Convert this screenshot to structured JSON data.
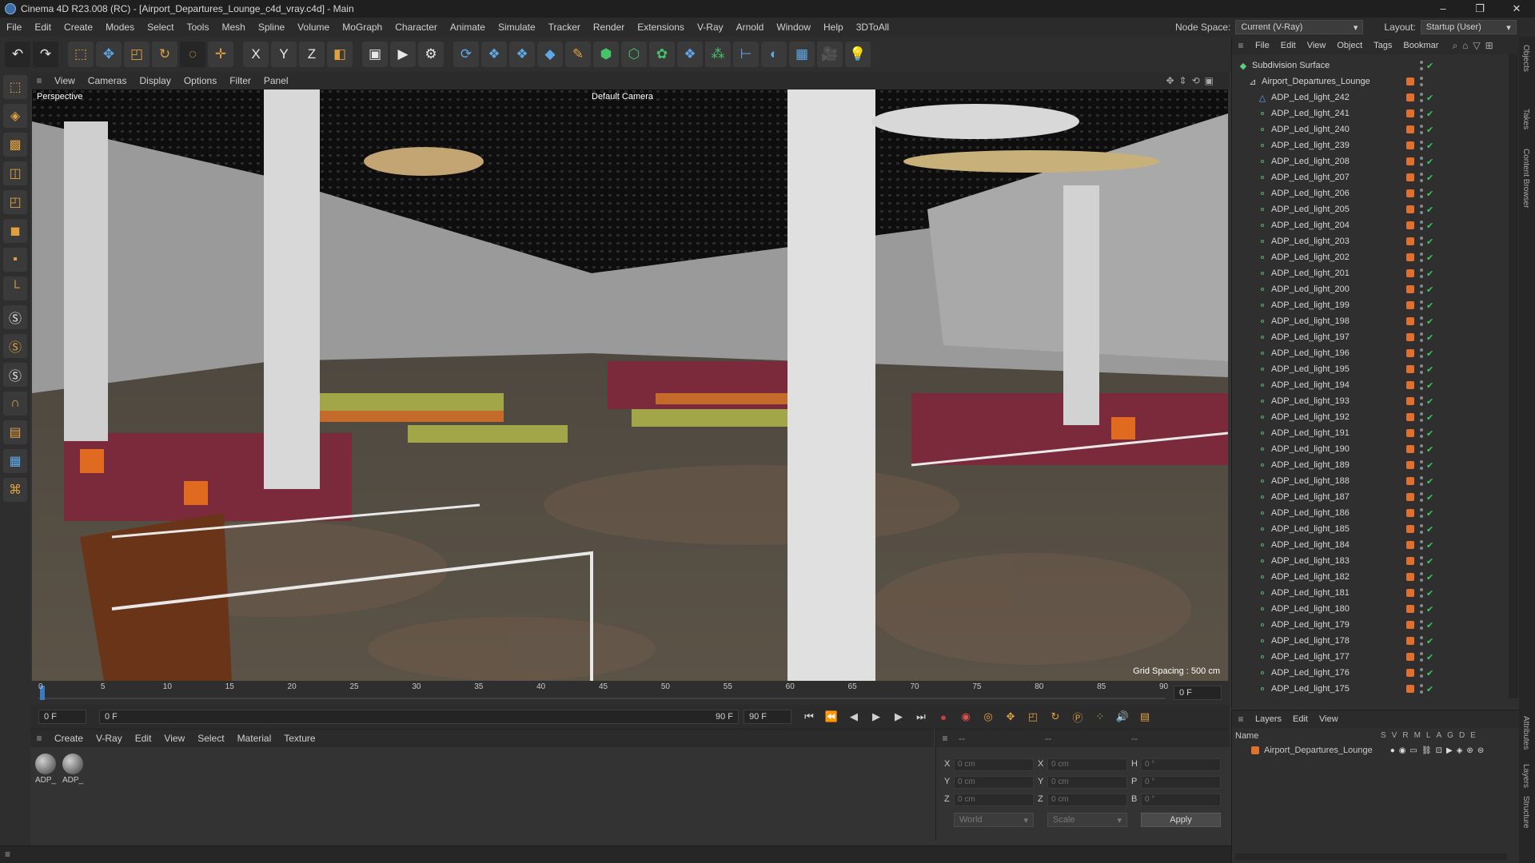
{
  "window": {
    "title": "Cinema 4D R23.008 (RC) - [Airport_Departures_Lounge_c4d_vray.c4d] - Main",
    "controls": [
      "–",
      "❐",
      "✕"
    ]
  },
  "menu": {
    "items": [
      "File",
      "Edit",
      "Create",
      "Modes",
      "Select",
      "Tools",
      "Mesh",
      "Spline",
      "Volume",
      "MoGraph",
      "Character",
      "Animate",
      "Simulate",
      "Tracker",
      "Render",
      "Extensions",
      "V-Ray",
      "Arnold",
      "Window",
      "Help",
      "3DToAll"
    ],
    "node_space_label": "Node Space:",
    "node_space_value": "Current (V-Ray)",
    "layout_label": "Layout:",
    "layout_value": "Startup (User)"
  },
  "toolbar": {
    "icons": [
      "undo-icon",
      "redo-icon",
      "live-selection-icon",
      "move-icon",
      "scale-icon",
      "rotate-icon",
      "recent-tools-icon",
      "transform-icon",
      "x-axis-icon",
      "y-axis-icon",
      "z-axis-icon",
      "coordinate-system-icon",
      "render-view-icon",
      "render-picture-viewer-icon",
      "render-settings-icon",
      "vray-icon",
      "python-icon",
      "python-icon",
      "cube-icon",
      "pen-icon",
      "subdivision-icon",
      "extrude-icon",
      "cloner-icon",
      "python-icon",
      "mograph-icon",
      "measure-icon",
      "deformer-icon",
      "floor-icon",
      "camera-icon",
      "light-icon"
    ],
    "axis_labels": [
      "X",
      "Y",
      "Z"
    ]
  },
  "viewport": {
    "menu": [
      "View",
      "Cameras",
      "Display",
      "Options",
      "Filter",
      "Panel"
    ],
    "projection": "Perspective",
    "camera": "Default Camera",
    "grid_spacing": "Grid Spacing : 500 cm"
  },
  "timeline": {
    "ticks": [
      "0",
      "5",
      "10",
      "15",
      "20",
      "25",
      "30",
      "35",
      "40",
      "45",
      "50",
      "55",
      "60",
      "65",
      "70",
      "75",
      "80",
      "85",
      "90"
    ],
    "current_frame_field": "0 F",
    "range_start": "0 F",
    "range_end": "90 F",
    "max_frame": "90 F",
    "end_frame_field": "0 F"
  },
  "material_manager": {
    "menu": [
      "Create",
      "V-Ray",
      "Edit",
      "View",
      "Select",
      "Material",
      "Texture"
    ],
    "materials": [
      "ADP_",
      "ADP_"
    ]
  },
  "coordinates": {
    "pos_labels": [
      "X",
      "Y",
      "Z"
    ],
    "size_labels": [
      "X",
      "Y",
      "Z"
    ],
    "rot_labels": [
      "H",
      "P",
      "B"
    ],
    "pos_values": [
      "0 cm",
      "0 cm",
      "0 cm"
    ],
    "size_values": [
      "0 cm",
      "0 cm",
      "0 cm"
    ],
    "rot_values": [
      "0 °",
      "0 °",
      "0 °"
    ],
    "header_a": "--",
    "header_b": "--",
    "header_c": "--",
    "world_select": "World",
    "scale_select": "Scale",
    "apply_label": "Apply"
  },
  "object_manager": {
    "menu": [
      "File",
      "Edit",
      "View",
      "Object",
      "Tags",
      "Bookmar"
    ],
    "root_items": [
      "Subdivision Surface",
      "Airport_Departures_Lounge"
    ],
    "lights": [
      "ADP_Led_light_242",
      "ADP_Led_light_241",
      "ADP_Led_light_240",
      "ADP_Led_light_239",
      "ADP_Led_light_208",
      "ADP_Led_light_207",
      "ADP_Led_light_206",
      "ADP_Led_light_205",
      "ADP_Led_light_204",
      "ADP_Led_light_203",
      "ADP_Led_light_202",
      "ADP_Led_light_201",
      "ADP_Led_light_200",
      "ADP_Led_light_199",
      "ADP_Led_light_198",
      "ADP_Led_light_197",
      "ADP_Led_light_196",
      "ADP_Led_light_195",
      "ADP_Led_light_194",
      "ADP_Led_light_193",
      "ADP_Led_light_192",
      "ADP_Led_light_191",
      "ADP_Led_light_190",
      "ADP_Led_light_189",
      "ADP_Led_light_188",
      "ADP_Led_light_187",
      "ADP_Led_light_186",
      "ADP_Led_light_185",
      "ADP_Led_light_184",
      "ADP_Led_light_183",
      "ADP_Led_light_182",
      "ADP_Led_light_181",
      "ADP_Led_light_180",
      "ADP_Led_light_179",
      "ADP_Led_light_178",
      "ADP_Led_light_177",
      "ADP_Led_light_176",
      "ADP_Led_light_175"
    ],
    "accent_tag": "#e0702c",
    "check_color": "#3cc75a"
  },
  "side_tabs": {
    "top": [
      "Objects",
      "Takes",
      "Content Browser"
    ],
    "bottom": [
      "Attributes",
      "Layers",
      "Structure"
    ]
  },
  "layer_manager": {
    "menu": [
      "Layers",
      "Edit",
      "View"
    ],
    "name_header": "Name",
    "columns": [
      "S",
      "V",
      "R",
      "M",
      "L",
      "A",
      "G",
      "D",
      "E"
    ],
    "layers": [
      "Airport_Departures_Lounge"
    ]
  }
}
